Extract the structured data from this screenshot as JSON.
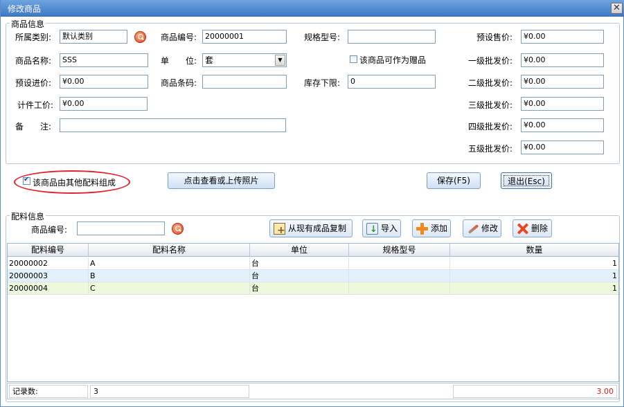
{
  "window": {
    "title": "修改商品",
    "close_glyph": "✕"
  },
  "product_group": {
    "title": "商品信息",
    "category_label": "所属类别:",
    "category_value": "默认类别",
    "code_label": "商品编号:",
    "code_value": "20000001",
    "spec_label": "规格型号:",
    "spec_value": "",
    "name_label": "商品名称:",
    "name_value": "SSS",
    "unit_label": "单　　位:",
    "unit_value": "套",
    "gift_label": "该商品可作为赠品",
    "gift_checked": false,
    "purchase_label": "预设进价:",
    "purchase_value": "¥0.00",
    "barcode_label": "商品条码:",
    "barcode_value": "",
    "stock_min_label": "库存下限:",
    "stock_min_value": "0",
    "piece_wage_label": "计件工价:",
    "piece_wage_value": "¥0.00",
    "remark_label": "备　　注:",
    "remark_value": "",
    "prices": [
      {
        "label": "预设售价:",
        "value": "¥0.00"
      },
      {
        "label": "一级批发价:",
        "value": "¥0.00"
      },
      {
        "label": "二级批发价:",
        "value": "¥0.00"
      },
      {
        "label": "三级批发价:",
        "value": "¥0.00"
      },
      {
        "label": "四级批发价:",
        "value": "¥0.00"
      },
      {
        "label": "五级批发价:",
        "value": "¥0.00"
      }
    ]
  },
  "options": {
    "composed_label": "该商品由其他配料组成",
    "composed_checked": true,
    "photo_button": "点击查看或上传照片",
    "save_button": "保存(F5)",
    "exit_button": "退出(Esc)"
  },
  "ingredients_group": {
    "title": "配料信息",
    "code_label": "商品编号:",
    "code_value": "",
    "copy_button": "从现有成品复制",
    "import_button": "导入",
    "add_button": "添加",
    "edit_button": "修改",
    "delete_button": "删除"
  },
  "grid": {
    "columns": [
      "配料编号",
      "配料名称",
      "单位",
      "规格型号",
      "数量"
    ],
    "rows": [
      [
        "20000002",
        "A",
        "台",
        "",
        "1"
      ],
      [
        "20000003",
        "B",
        "台",
        "",
        "1"
      ],
      [
        "20000004",
        "C",
        "台",
        "",
        "1"
      ]
    ],
    "row_colors": [
      "#ffffff",
      "#e3f1fb",
      "#eef8dc"
    ]
  },
  "status": {
    "count_label": "记录数:",
    "count_value": "3",
    "total_value": "3.00",
    "total_color": "#d0201a"
  },
  "colors": {
    "highlight": "#e0212f",
    "title_bar": "#4f88cf"
  }
}
